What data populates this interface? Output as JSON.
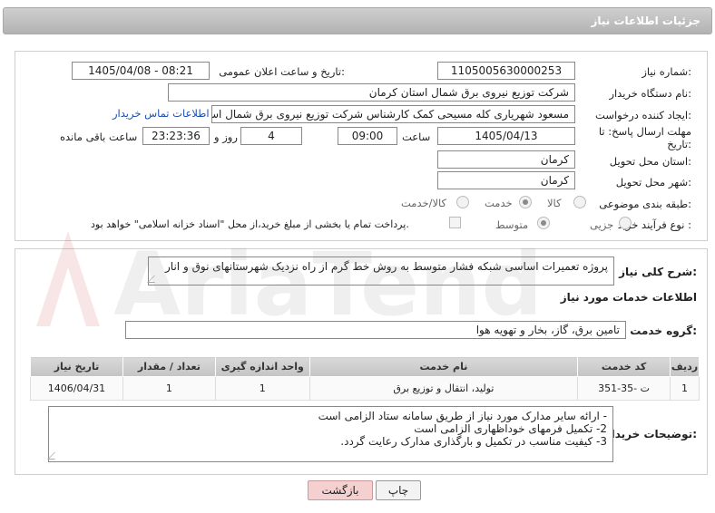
{
  "header": {
    "title": "جزئیات اطلاعات نیاز"
  },
  "need_number": {
    "label": "شماره نیاز:",
    "value": "1105005630000253"
  },
  "announce": {
    "label": "تاریخ و ساعت اعلان عمومی:",
    "value": "1405/04/08 - 08:21"
  },
  "buyer_org": {
    "label": "نام دستگاه خریدار:",
    "value": "شرکت توزیع نیروی برق شمال استان کرمان"
  },
  "requester": {
    "label": "ایجاد کننده درخواست:",
    "value": "مسعود شهریاری کله مسیحی کمک کارشناس شرکت توزیع نیروی برق شمال استان کرمان",
    "contact_link": "اطلاعات تماس خریدار"
  },
  "deadline": {
    "label": "مهلت ارسال پاسخ: تا تاریخ:",
    "date": "1405/04/13",
    "time_label": "ساعت",
    "time": "09:00",
    "days": "4",
    "days_label": "روز و",
    "remaining": "23:23:36",
    "remaining_label": "ساعت باقی مانده"
  },
  "delivery_province": {
    "label": "استان محل تحویل:",
    "value": "کرمان"
  },
  "delivery_city": {
    "label": "شهر محل تحویل:",
    "value": "کرمان"
  },
  "category": {
    "label": "طبقه بندی موضوعی:",
    "options": [
      "کالا",
      "خدمت",
      "کالا/خدمت"
    ],
    "selected": "خدمت"
  },
  "purchase_type": {
    "label": "نوع فرآیند خرید :",
    "options": [
      "جزیی",
      "متوسط"
    ],
    "selected": "متوسط",
    "note": "پرداخت تمام یا بخشی از مبلغ خرید،از محل \"اسناد خزانه اسلامی\" خواهد بود."
  },
  "description": {
    "label": "شرح کلی نیاز:",
    "value": "پروژه تعمیرات اساسی شبکه فشار متوسط به روش خط گرم از راه نزدیک شهرستانهای نوق و انار"
  },
  "services_title": "اطلاعات خدمات مورد نیاز",
  "service_group": {
    "label": "گروه خدمت:",
    "value": "تامین برق، گاز، بخار و تهویه هوا"
  },
  "table": {
    "headers": [
      "ردیف",
      "کد خدمت",
      "نام خدمت",
      "واحد اندازه گیری",
      "تعداد / مقدار",
      "تاریخ نیاز"
    ],
    "rows": [
      [
        "1",
        "ت -35-351",
        "تولید، انتقال و توزیع برق",
        "1",
        "1",
        "1406/04/31"
      ]
    ]
  },
  "buyer_notes": {
    "label": "توضیحات خریدار:",
    "lines": [
      "- ارائه سایر مدارک مورد نیاز از طریق سامانه ستاد الزامی است",
      "2- تکمیل فرمهای خوداظهاری الزامی است",
      "3- کیفیت مناسب در تکمیل و بارگذاری مدارک رعایت گردد."
    ]
  },
  "buttons": {
    "print": "چاپ",
    "back": "بازگشت"
  },
  "watermark": {
    "text": "AriaTender.net"
  }
}
